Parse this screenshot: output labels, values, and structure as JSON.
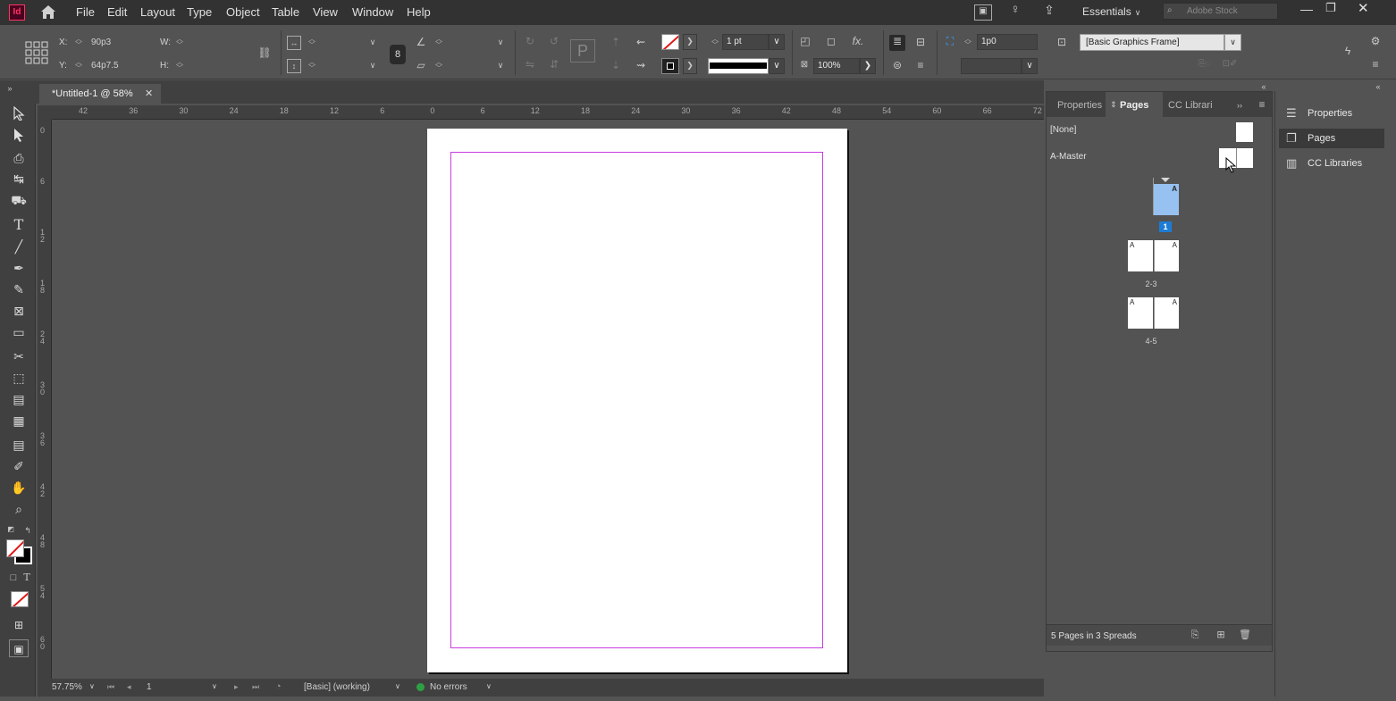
{
  "app": {
    "logo": "Id",
    "workspace": "Essentials",
    "search_placeholder": "Adobe Stock"
  },
  "menu": [
    "File",
    "Edit",
    "Layout",
    "Type",
    "Object",
    "Table",
    "View",
    "Window",
    "Help"
  ],
  "control": {
    "x_label": "X:",
    "x_value": "90p3",
    "y_label": "Y:",
    "y_value": "64p7.5",
    "w_label": "W:",
    "h_label": "H:",
    "stroke_weight": "1 pt",
    "opacity": "100%",
    "fitting_value": "1p0",
    "object_style": "[Basic Graphics Frame]"
  },
  "document": {
    "tab_title": "*Untitled-1 @ 58%"
  },
  "hruler_ticks": [
    "42",
    "36",
    "30",
    "24",
    "18",
    "12",
    "6",
    "0",
    "6",
    "12",
    "18",
    "24",
    "30",
    "36",
    "42",
    "48",
    "54",
    "60",
    "66",
    "72"
  ],
  "vruler_ticks": [
    "0",
    "6",
    "1 2",
    "1 8",
    "2 4",
    "3 0",
    "3 6",
    "4 2",
    "4 8",
    "5 4",
    "6 0"
  ],
  "status": {
    "zoom": "57.75%",
    "page": "1",
    "preflight_profile": "[Basic] (working)",
    "errors": "No errors"
  },
  "pages_panel": {
    "tabs": [
      "Properties",
      "Pages",
      "CC Librari"
    ],
    "masters": [
      "[None]",
      "A-Master"
    ],
    "pages": [
      {
        "label": "1",
        "master": "A"
      },
      {
        "label": "2-3",
        "master": "A"
      },
      {
        "label": "4-5",
        "master": "A"
      }
    ],
    "footer": "5 Pages in 3 Spreads"
  },
  "dock": {
    "items": [
      "Properties",
      "Pages",
      "CC Libraries"
    ]
  }
}
